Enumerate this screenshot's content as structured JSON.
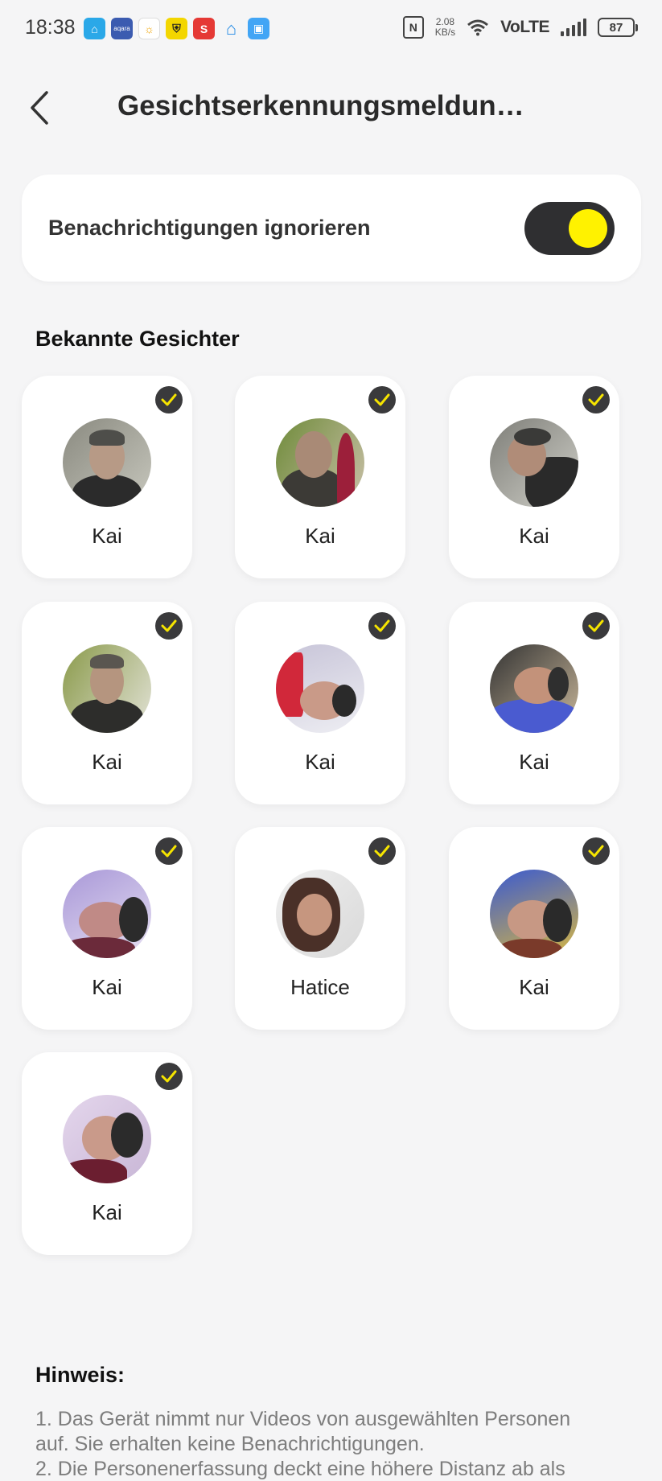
{
  "status_bar": {
    "time": "18:38",
    "apps": [
      {
        "icon": "home-app-icon",
        "color": "#2aa8e8",
        "glyph": "⌂"
      },
      {
        "icon": "aqara-app-icon",
        "color": "#3b5bb0",
        "glyph": "aqara"
      },
      {
        "icon": "weather-app-icon",
        "color": "#f0c400",
        "glyph": "☼"
      },
      {
        "icon": "shield-app-icon",
        "color": "#f3d600",
        "glyph": "⛨"
      },
      {
        "icon": "s-app-icon",
        "color": "#e53935",
        "glyph": "S"
      },
      {
        "icon": "smarthome-app-icon",
        "color": "#1e88e5",
        "glyph": "⌂"
      },
      {
        "icon": "clipboard-app-icon",
        "color": "#42a5f5",
        "glyph": "▣"
      }
    ],
    "nfc": "N",
    "speed_value": "2.08",
    "speed_unit": "KB/s",
    "network": "VoLTE",
    "battery": "87"
  },
  "header": {
    "title": "Gesichtserkennungsmeldun…"
  },
  "toggle_card": {
    "label": "Benachrichtigungen ignorieren",
    "enabled": true,
    "accent": "#fff200"
  },
  "faces_section": {
    "title": "Bekannte Gesichter",
    "faces": [
      {
        "name": "Kai",
        "selected": true
      },
      {
        "name": "Kai",
        "selected": true
      },
      {
        "name": "Kai",
        "selected": true
      },
      {
        "name": "Kai",
        "selected": true
      },
      {
        "name": "Kai",
        "selected": true
      },
      {
        "name": "Kai",
        "selected": true
      },
      {
        "name": "Kai",
        "selected": true
      },
      {
        "name": "Hatice",
        "selected": true
      },
      {
        "name": "Kai",
        "selected": true
      },
      {
        "name": "Kai",
        "selected": true
      }
    ]
  },
  "notice": {
    "title": "Hinweis:",
    "lines": [
      "1. Das Gerät nimmt nur Videos von ausgewählten Personen",
      "auf. Sie erhalten keine Benachrichtigungen.",
      "2. Die Personenerfassung deckt eine höhere Distanz ab als"
    ]
  }
}
